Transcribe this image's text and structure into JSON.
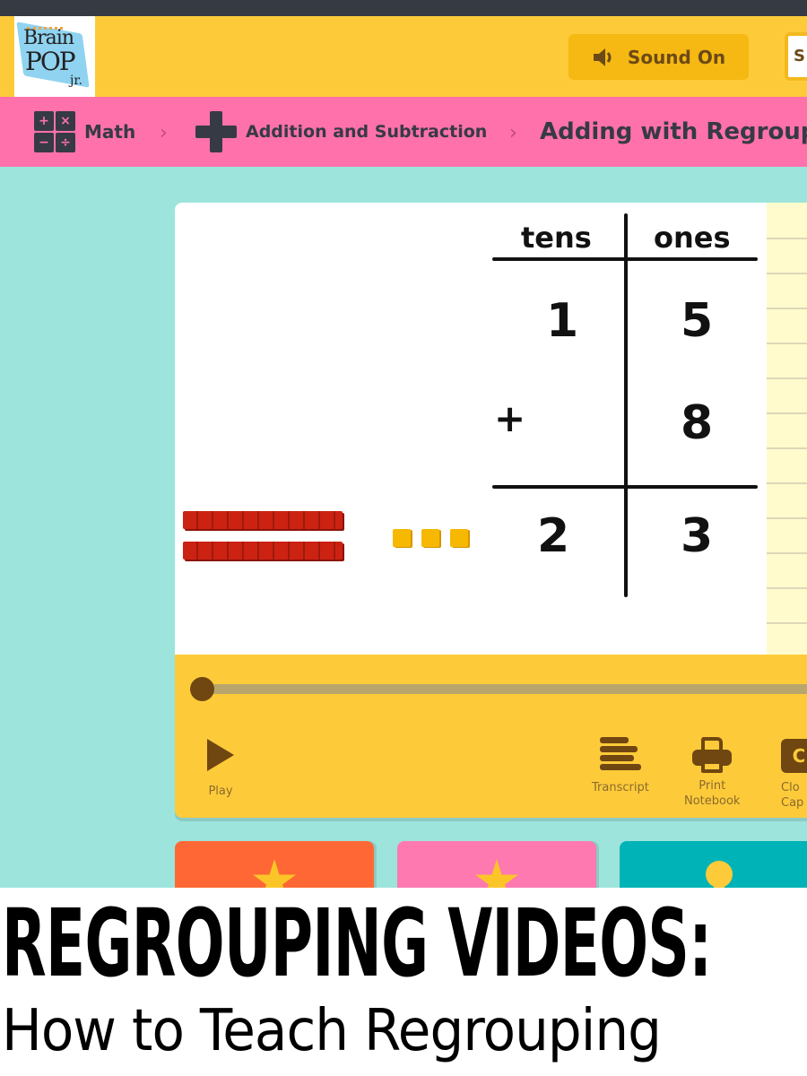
{
  "app": {
    "brand": {
      "line1": "Brain",
      "line2": "POP",
      "line3": "jr."
    }
  },
  "header": {
    "sound_button": {
      "label": "Sound On",
      "icon": "speaker-icon"
    },
    "search_partial": "S"
  },
  "breadcrumb": {
    "items": [
      {
        "label": "Math",
        "icon": "math-operations-icon"
      },
      {
        "label": "Addition and Subtraction",
        "icon": "plus-icon"
      },
      {
        "label": "Adding with Regroup"
      }
    ],
    "separator": "›"
  },
  "video": {
    "place_value_chart": {
      "headers": [
        "tens",
        "ones"
      ],
      "rows": [
        {
          "operator": "",
          "tens": "1",
          "ones": "5"
        },
        {
          "operator": "+",
          "tens": "",
          "ones": "8"
        }
      ],
      "result": {
        "tens": "2",
        "ones": "3"
      }
    },
    "base_ten_blocks": {
      "ten_rods": 2,
      "unit_cubes": 3
    },
    "progress": 0
  },
  "controls": {
    "play": {
      "label": "Play"
    },
    "transcript": {
      "label": "Transcript"
    },
    "print": {
      "line1": "Print",
      "line2": "Notebook"
    },
    "captions": {
      "line1": "Clo",
      "line2": "Cap",
      "icon_text": "C"
    }
  },
  "cards": [
    {
      "color": "#ff6834",
      "icon": "star-icon"
    },
    {
      "color": "#fe79b0",
      "icon": "star-icon"
    },
    {
      "color": "#00b3b6",
      "icon": "lightbulb-icon"
    }
  ],
  "caption": {
    "title": "REGROUPING VIDEOS:",
    "subtitle": "How to Teach Regrouping"
  },
  "colors": {
    "topbar": "#353a43",
    "header": "#fdcb3a",
    "breadcrumb": "#fe71ab",
    "background": "#9de4dc",
    "controls_dark": "#704611"
  }
}
